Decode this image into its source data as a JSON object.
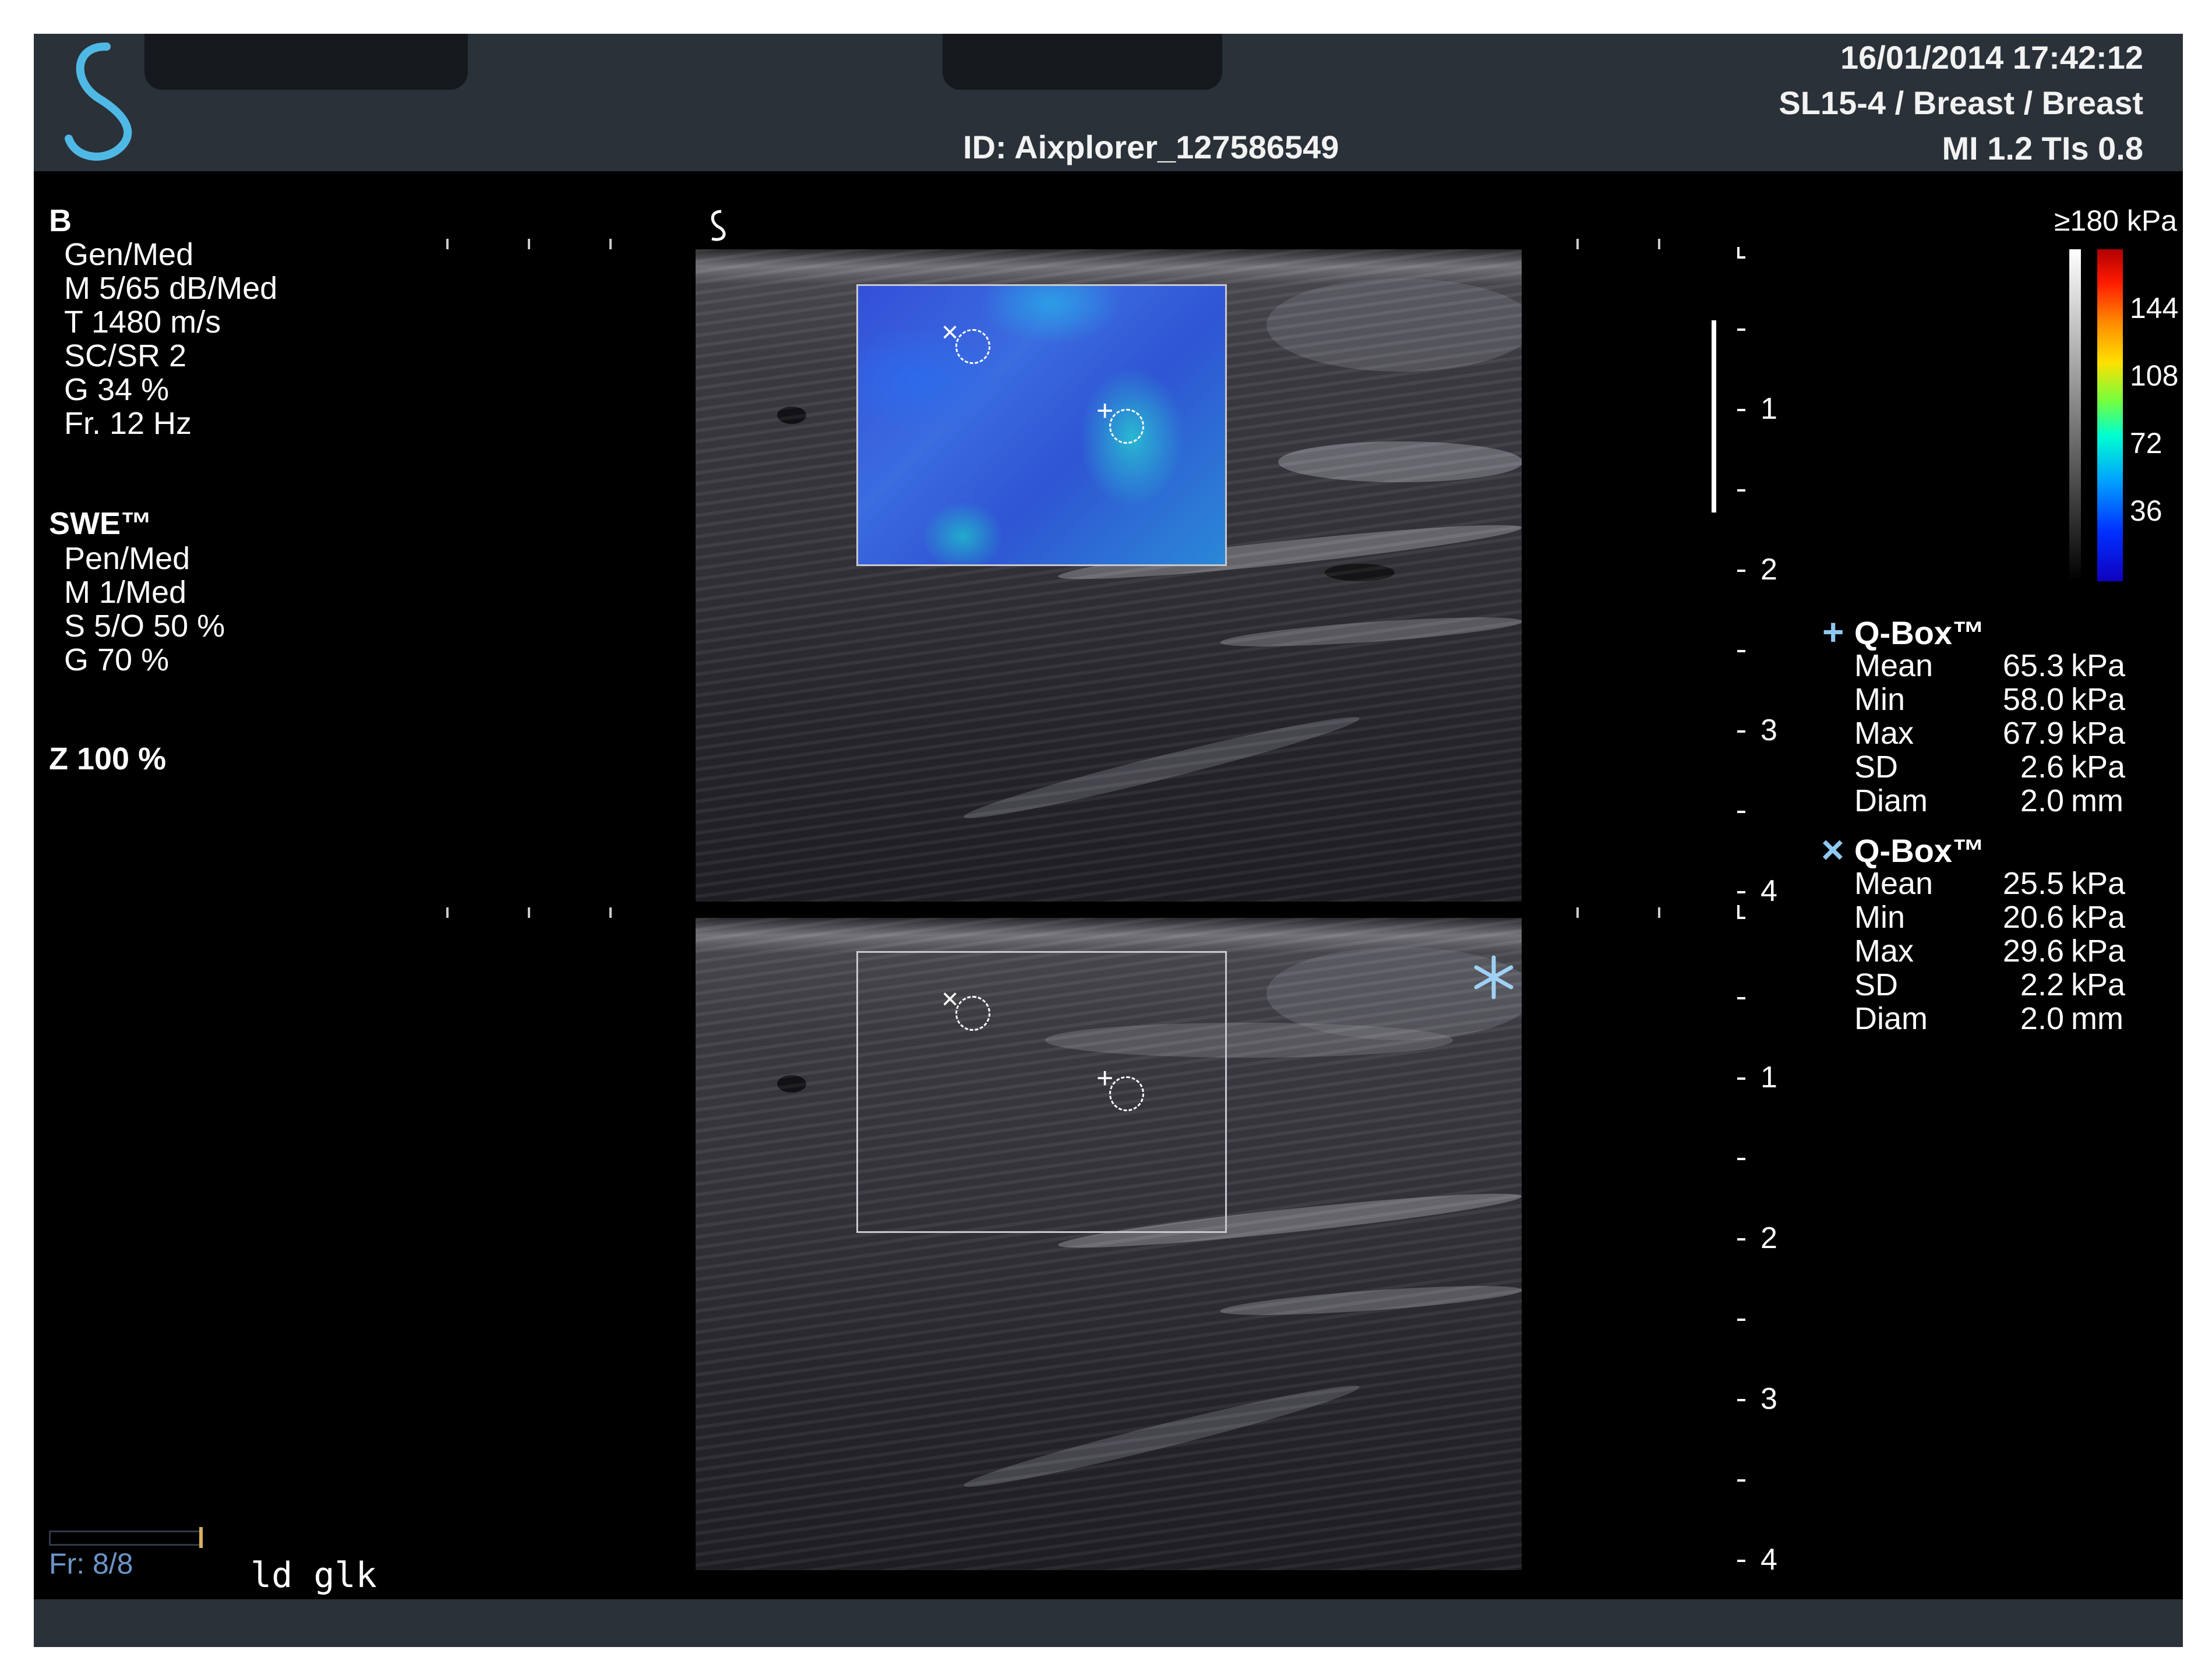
{
  "header": {
    "id": "ID: Aixplorer_127586549",
    "datetime": "16/01/2014 17:42:12",
    "probe": "SL15-4 / Breast / Breast",
    "indices": "MI 1.2  TIs 0.8"
  },
  "bmode": {
    "title": "B",
    "lines": [
      "Gen/Med",
      "M 5/65 dB/Med",
      "T 1480 m/s",
      "SC/SR 2",
      "G 34 %",
      "Fr. 12 Hz"
    ]
  },
  "swe": {
    "title": "SWE™",
    "lines": [
      "Pen/Med",
      "M 1/Med",
      "S 5/O 50 %",
      "G 70 %"
    ]
  },
  "zoom": "Z  100  %",
  "frame": "Fr: 8/8",
  "annotation": "ld glk",
  "colorbar": {
    "max_label": "≥180 kPa",
    "ticks": [
      "144",
      "108",
      "72",
      "36"
    ]
  },
  "depth_scale": {
    "top": [
      "1",
      "2",
      "3",
      "4"
    ],
    "bottom": [
      "1",
      "2",
      "3",
      "4"
    ]
  },
  "qboxes": [
    {
      "marker": "+",
      "title": "Q-Box™",
      "rows": [
        {
          "label": "Mean",
          "value": "65.3",
          "unit": "kPa"
        },
        {
          "label": "Min",
          "value": "58.0",
          "unit": "kPa"
        },
        {
          "label": "Max",
          "value": "67.9",
          "unit": "kPa"
        },
        {
          "label": "SD",
          "value": "2.6",
          "unit": "kPa"
        },
        {
          "label": "Diam",
          "value": "2.0",
          "unit": "mm"
        }
      ]
    },
    {
      "marker": "×",
      "title": "Q-Box™",
      "rows": [
        {
          "label": "Mean",
          "value": "25.5",
          "unit": "kPa"
        },
        {
          "label": "Min",
          "value": "20.6",
          "unit": "kPa"
        },
        {
          "label": "Max",
          "value": "29.6",
          "unit": "kPa"
        },
        {
          "label": "SD",
          "value": "2.2",
          "unit": "kPa"
        },
        {
          "label": "Diam",
          "value": "2.0",
          "unit": "mm"
        }
      ]
    }
  ],
  "icons": {
    "logo": "supersonic-s-logo-icon",
    "freeze": "snowflake-icon"
  },
  "colors": {
    "header_bg": "#2a3138",
    "logo": "#4fb9e6",
    "frame_text": "#6d94c8",
    "qbox_marker": "#8fc8f0"
  }
}
